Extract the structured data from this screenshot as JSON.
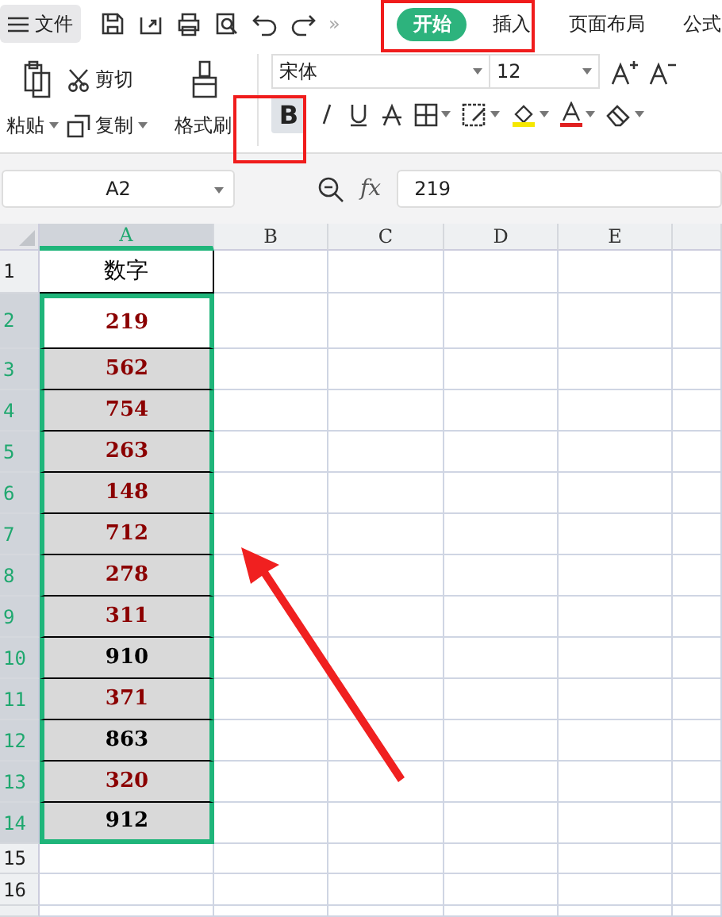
{
  "menu": {
    "label": "文件"
  },
  "more": "»",
  "ribbon_tabs": [
    {
      "label": "开始",
      "selected": true
    },
    {
      "label": "插入",
      "selected": false
    },
    {
      "label": "页面布局",
      "selected": false
    },
    {
      "label": "公式",
      "selected": false
    }
  ],
  "clipboard": {
    "paste": "粘贴",
    "cut": "剪切",
    "copy": "复制",
    "format_painter": "格式刷"
  },
  "font": {
    "name": "宋体",
    "size": "12",
    "bold_label": "B",
    "bold_selected": true
  },
  "name_box": "A2",
  "function_label": "fx",
  "formula": "219",
  "sheet": {
    "columns": [
      {
        "label": "A",
        "selected": true
      },
      {
        "label": "B",
        "selected": false
      },
      {
        "label": "C",
        "selected": false
      },
      {
        "label": "D",
        "selected": false
      },
      {
        "label": "E",
        "selected": false
      }
    ],
    "rows": [
      {
        "label": "1",
        "selected": false,
        "cell": "数字",
        "shaded": false,
        "color": "#000000"
      },
      {
        "label": "2",
        "selected": true,
        "cell": "219",
        "shaded": false,
        "color": "#8b0000"
      },
      {
        "label": "3",
        "selected": true,
        "cell": "562",
        "shaded": true,
        "color": "#8b0000"
      },
      {
        "label": "4",
        "selected": true,
        "cell": "754",
        "shaded": true,
        "color": "#8b0000"
      },
      {
        "label": "5",
        "selected": true,
        "cell": "263",
        "shaded": true,
        "color": "#8b0000"
      },
      {
        "label": "6",
        "selected": true,
        "cell": "148",
        "shaded": true,
        "color": "#8b0000"
      },
      {
        "label": "7",
        "selected": true,
        "cell": "712",
        "shaded": true,
        "color": "#8b0000"
      },
      {
        "label": "8",
        "selected": true,
        "cell": "278",
        "shaded": true,
        "color": "#8b0000"
      },
      {
        "label": "9",
        "selected": true,
        "cell": "311",
        "shaded": true,
        "color": "#8b0000"
      },
      {
        "label": "10",
        "selected": true,
        "cell": "910",
        "shaded": true,
        "color": "#000000"
      },
      {
        "label": "11",
        "selected": true,
        "cell": "371",
        "shaded": true,
        "color": "#8b0000"
      },
      {
        "label": "12",
        "selected": true,
        "cell": "863",
        "shaded": true,
        "color": "#000000"
      },
      {
        "label": "13",
        "selected": true,
        "cell": "320",
        "shaded": true,
        "color": "#8b0000"
      },
      {
        "label": "14",
        "selected": true,
        "cell": "912",
        "shaded": true,
        "color": "#000000"
      },
      {
        "label": "15",
        "selected": false
      },
      {
        "label": "16",
        "selected": false
      }
    ]
  }
}
